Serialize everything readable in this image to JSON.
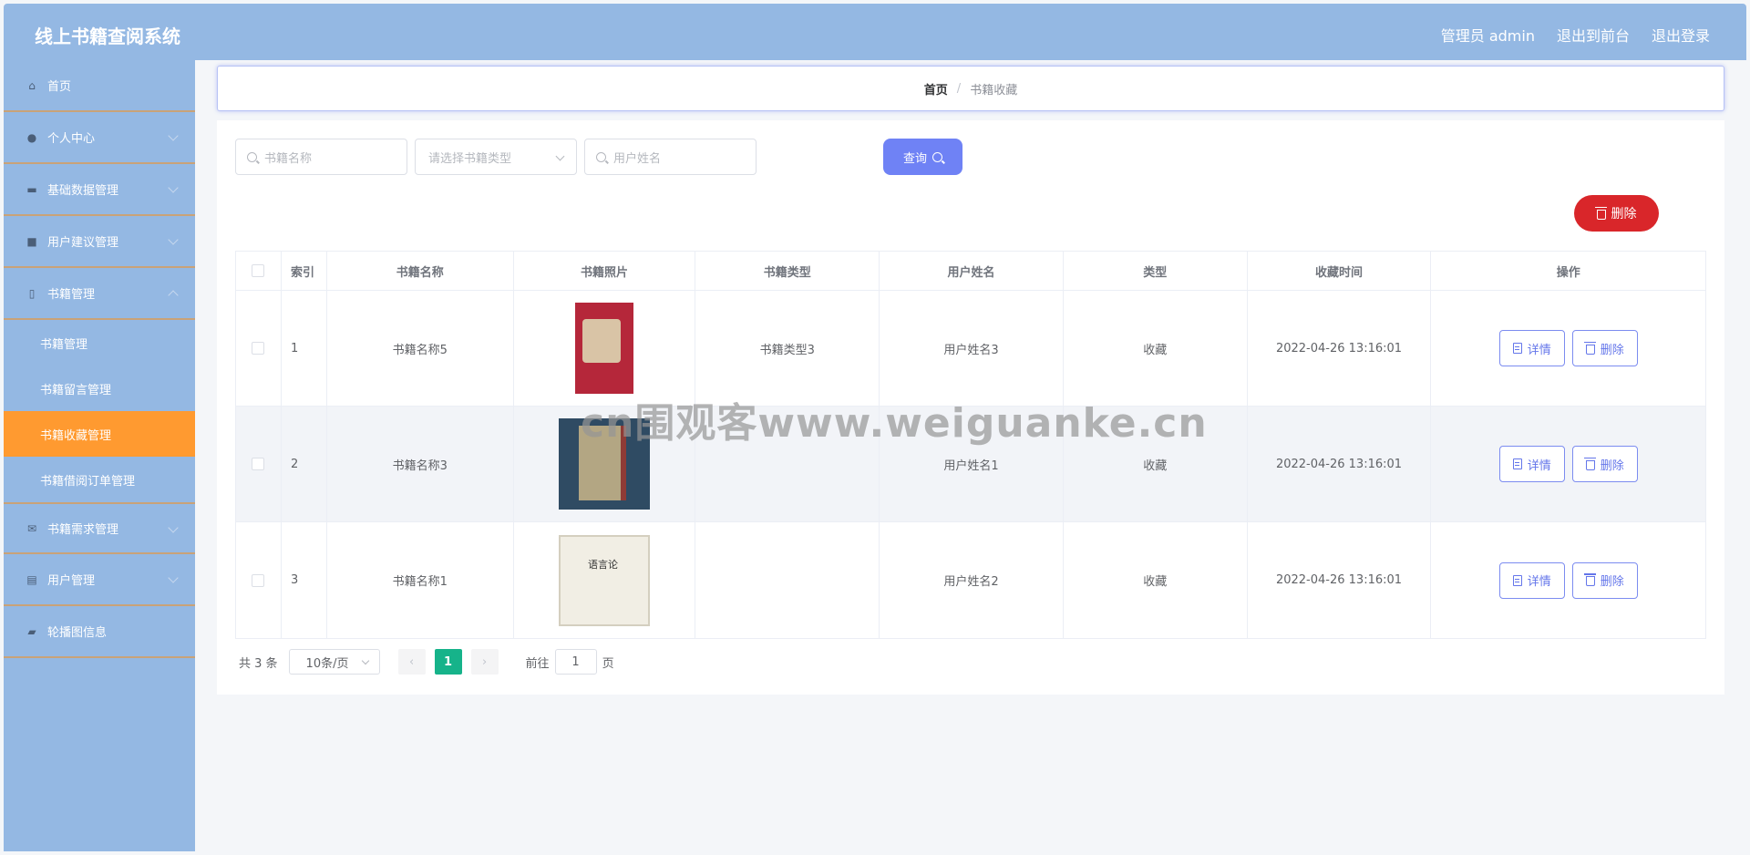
{
  "header": {
    "title": "线上书籍查阅系统",
    "admin": "管理员 admin",
    "to_front": "退出到前台",
    "logout": "退出登录"
  },
  "sidebar": {
    "items": [
      {
        "label": "首页",
        "icon": "home-icon"
      },
      {
        "label": "个人中心",
        "icon": "user-icon"
      },
      {
        "label": "基础数据管理",
        "icon": "wallet-icon"
      },
      {
        "label": "用户建议管理",
        "icon": "briefcase-icon"
      },
      {
        "label": "书籍管理",
        "icon": "phone-icon"
      },
      {
        "label": "书籍需求管理",
        "icon": "mail-icon"
      },
      {
        "label": "用户管理",
        "icon": "clipboard-icon"
      },
      {
        "label": "轮播图信息",
        "icon": "ticket-icon"
      }
    ],
    "sub_items": [
      "书籍管理",
      "书籍留言管理",
      "书籍收藏管理",
      "书籍借阅订单管理"
    ],
    "active_color": "#ff9a30"
  },
  "breadcrumb": {
    "home": "首页",
    "separator": "/",
    "current": "书籍收藏"
  },
  "search": {
    "book_name_placeholder": "书籍名称",
    "book_type_placeholder": "请选择书籍类型",
    "user_name_placeholder": "用户姓名",
    "query_label": "查询"
  },
  "bulk_delete_label": "删除",
  "table": {
    "headers": [
      "索引",
      "书籍名称",
      "书籍照片",
      "书籍类型",
      "用户姓名",
      "类型",
      "收藏时间",
      "操作"
    ],
    "rows": [
      {
        "index": "1",
        "name": "书籍名称5",
        "type": "书籍类型3",
        "user": "用户姓名3",
        "kind": "收藏",
        "time": "2022-04-26 13:16:01"
      },
      {
        "index": "2",
        "name": "书籍名称3",
        "type": "",
        "user": "用户姓名1",
        "kind": "收藏",
        "time": "2022-04-26 13:16:01"
      },
      {
        "index": "3",
        "name": "书籍名称1",
        "type": "",
        "user": "用户姓名2",
        "kind": "收藏",
        "time": "2022-04-26 13:16:01"
      }
    ],
    "detail_label": "详情",
    "delete_label": "删除"
  },
  "pagination": {
    "total": "共 3 条",
    "page_size": "10条/页",
    "current_page": "1",
    "goto_label": "前往",
    "goto_value": "1",
    "page_suffix": "页"
  },
  "watermark": "cn围观客www.weiguanke.cn"
}
